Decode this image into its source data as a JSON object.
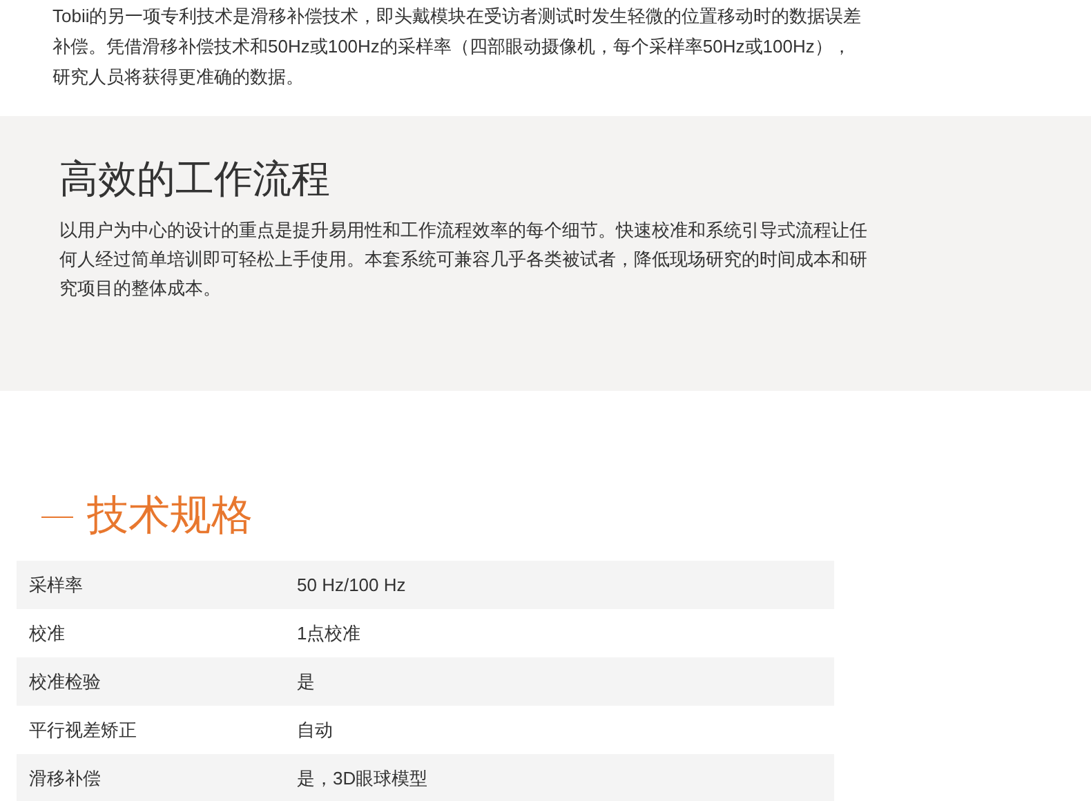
{
  "intro": {
    "text": "Tobii的另一项专利技术是滑移补偿技术，即头戴模块在受访者测试时发生轻微的位置移动时的数据误差补偿。凭借滑移补偿技术和50Hz或100Hz的采样率（四部眼动摄像机，每个采样率50Hz或100Hz），研究人员将获得更准确的数据。"
  },
  "workflow": {
    "title": "高效的工作流程",
    "text": "以用户为中心的设计的重点是提升易用性和工作流程效率的每个细节。快速校准和系统引导式流程让任何人经过简单培训即可轻松上手使用。本套系统可兼容几乎各类被试者，降低现场研究的时间成本和研究项目的整体成本。"
  },
  "specs": {
    "title": "技术规格",
    "rows": [
      {
        "label": "采样率",
        "value": "50 Hz/100 Hz"
      },
      {
        "label": "校准",
        "value": "1点校准"
      },
      {
        "label": "校准检验",
        "value": "是"
      },
      {
        "label": "平行视差矫正",
        "value": "自动"
      },
      {
        "label": "滑移补偿",
        "value": "是，3D眼球模型"
      }
    ]
  }
}
